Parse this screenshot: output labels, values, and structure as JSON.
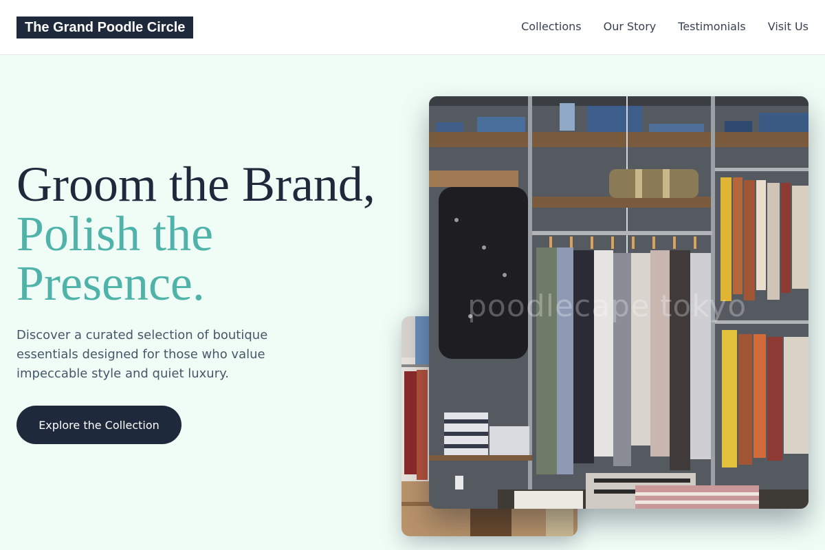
{
  "header": {
    "logo": "The Grand Poodle Circle",
    "nav": [
      "Collections",
      "Our Story",
      "Testimonials",
      "Visit Us"
    ]
  },
  "hero": {
    "headline_line1": "Groom the Brand,",
    "headline_line2": "Polish the",
    "headline_line3": "Presence.",
    "description": "Discover a curated selection of boutique essentials designed for those who value impeccable style and quiet luxury.",
    "cta_label": "Explore the Collection"
  },
  "images": {
    "watermark": "poodlecape tokyo"
  },
  "colors": {
    "page_bg": "#f0fdf6",
    "dark": "#1e293b",
    "accent": "#4fb3a9"
  }
}
